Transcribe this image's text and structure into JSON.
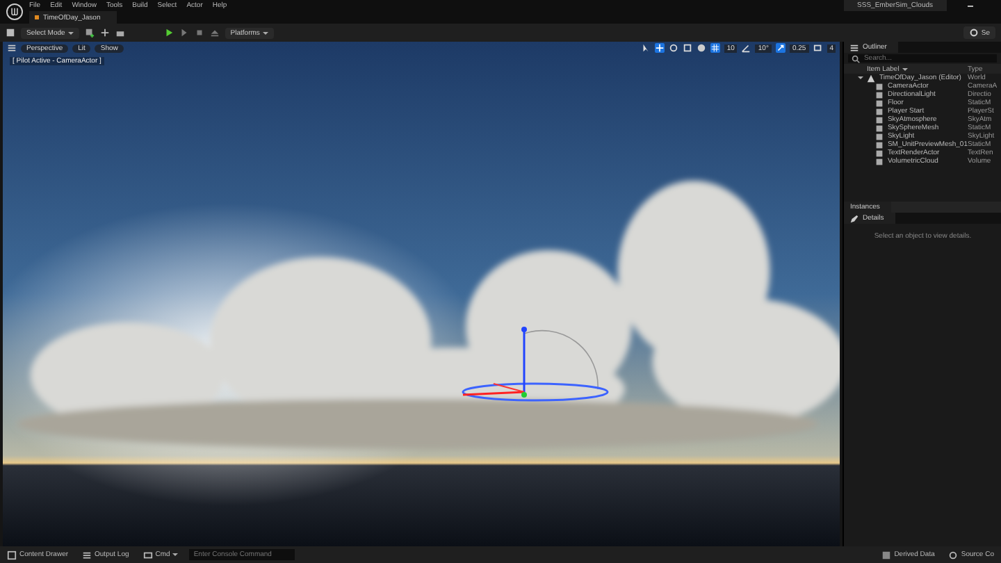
{
  "menu": [
    "File",
    "Edit",
    "Window",
    "Tools",
    "Build",
    "Select",
    "Actor",
    "Help"
  ],
  "window": {
    "title": "SSS_EmberSim_Clouds",
    "level_tab": "TimeOfDay_Jason"
  },
  "toolbar": {
    "mode": "Select Mode",
    "platforms": "Platforms",
    "settings": "Se"
  },
  "viewport": {
    "view": "Perspective",
    "lit": "Lit",
    "show": "Show",
    "pilot": "[ Pilot Active - CameraActor ]",
    "grid": "10",
    "angle": "10°",
    "scale": "0.25",
    "camera_speed": "4"
  },
  "outliner": {
    "title": "Outliner",
    "search": {
      "placeholder": "Search..."
    },
    "col_label": "Item Label",
    "col_type": "Type",
    "rows": [
      {
        "label": "TimeOfDay_Jason (Editor)",
        "type": "World",
        "expanded": true,
        "children": [
          {
            "label": "CameraActor",
            "type": "CameraA"
          },
          {
            "label": "DirectionalLight",
            "type": "Directio"
          },
          {
            "label": "Floor",
            "type": "StaticM"
          },
          {
            "label": "Player Start",
            "type": "PlayerSt"
          },
          {
            "label": "SkyAtmosphere",
            "type": "SkyAtm"
          },
          {
            "label": "SkySphereMesh",
            "type": "StaticM"
          },
          {
            "label": "SkyLight",
            "type": "SkyLight"
          },
          {
            "label": "SM_UnitPreviewMesh_01",
            "type": "StaticM"
          },
          {
            "label": "TextRenderActor",
            "type": "TextRen"
          },
          {
            "label": "VolumetricCloud",
            "type": "Volume"
          }
        ]
      }
    ]
  },
  "structure": {
    "title": "Instances"
  },
  "details": {
    "title": "Details",
    "empty": "Select an object to view details."
  },
  "status_bar": {
    "content_drawer": "Content Drawer",
    "output_log": "Output Log",
    "cmd": "Cmd",
    "console": {
      "placeholder": "Enter Console Command"
    },
    "derived_data": "Derived Data",
    "source_control": "Source Co"
  }
}
